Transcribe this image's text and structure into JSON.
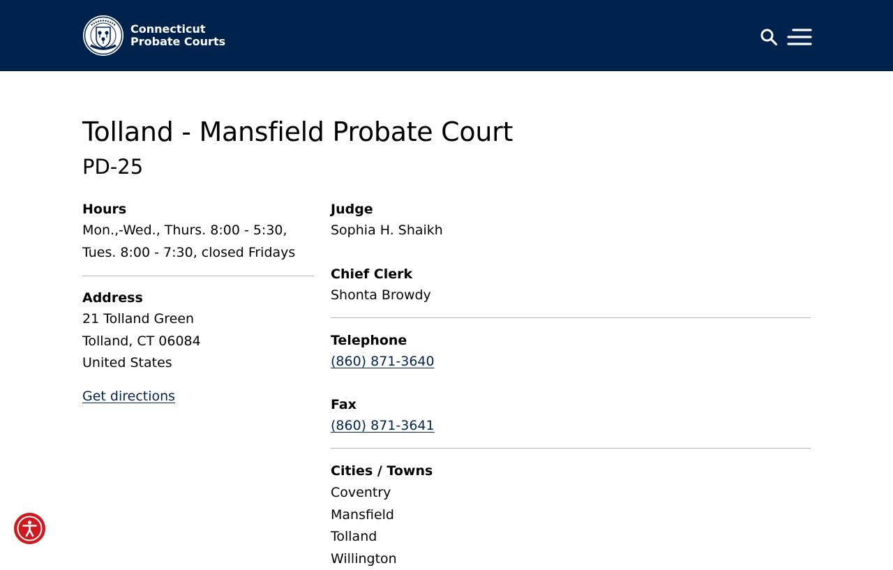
{
  "site": {
    "name_line1": "Connecticut",
    "name_line2": "Probate Courts"
  },
  "icons": {
    "logo": "connecticut-probate-courts-seal",
    "search": "search-icon",
    "menu": "hamburger-menu-icon",
    "accessibility": "accessibility-icon"
  },
  "colors": {
    "header_bg": "#00234e",
    "link": "#00234e",
    "accessibility_button": "#d0191f"
  },
  "court": {
    "title": "Tolland - Mansfield Probate Court",
    "district": "PD-25"
  },
  "hours": {
    "label": "Hours",
    "line1": "Mon.,-Wed., Thurs. 8:00 - 5:30,",
    "line2": "Tues. 8:00 - 7:30, closed Fridays"
  },
  "address": {
    "label": "Address",
    "street": "21 Tolland Green",
    "city": "Tolland, CT 06084",
    "country": "United States",
    "directions_label": "Get directions"
  },
  "judge": {
    "label": "Judge",
    "name": "Sophia H. Shaikh"
  },
  "chief_clerk": {
    "label": "Chief Clerk",
    "name": "Shonta Browdy"
  },
  "telephone": {
    "label": "Telephone",
    "number": "(860) 871-3640"
  },
  "fax": {
    "label": "Fax",
    "number": "(860) 871-3641"
  },
  "towns": {
    "label": "Cities / Towns",
    "items": [
      "Coventry",
      "Mansfield",
      "Tolland",
      "Willington"
    ]
  }
}
